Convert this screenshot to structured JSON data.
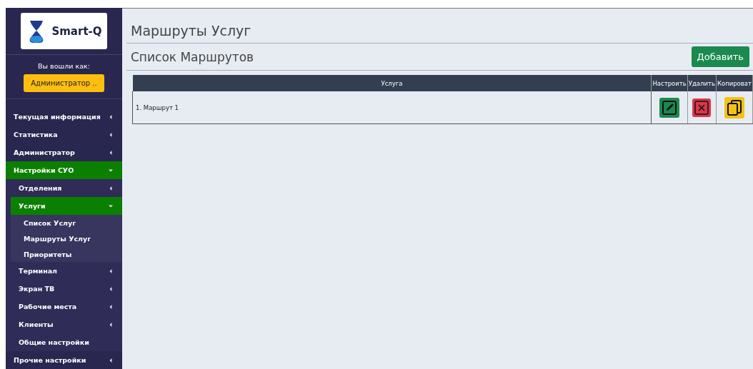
{
  "sidebar": {
    "logo": {
      "text": "Smart-Q"
    },
    "user_label": "Вы вошли как:",
    "user_button": "Администратор ..",
    "menu": [
      {
        "label": "Текущая информация",
        "expanded": false
      },
      {
        "label": "Статистика",
        "expanded": false
      },
      {
        "label": "Администратор",
        "expanded": false
      },
      {
        "label": "Настройки СУО",
        "expanded": true,
        "children": [
          {
            "label": "Отделения",
            "expanded": false
          },
          {
            "label": "Услуги",
            "expanded": true,
            "children": [
              {
                "label": "Список Услуг"
              },
              {
                "label": "Маршруты Услуг"
              },
              {
                "label": "Приоритеты"
              }
            ]
          },
          {
            "label": "Терминал",
            "expanded": false
          },
          {
            "label": "Экран ТВ",
            "expanded": false
          },
          {
            "label": "Рабочие места",
            "expanded": false
          },
          {
            "label": "Клиенты",
            "expanded": false
          },
          {
            "label": "Общие настройки"
          }
        ]
      },
      {
        "label": "Прочие настройки",
        "expanded": false
      }
    ]
  },
  "page_title": "Маршруты Услуг",
  "section_title": "Список Маршрутов",
  "add_button": "Добавить",
  "table": {
    "columns": [
      "Услуга",
      "Настроить",
      "Удалить",
      "Копироват"
    ],
    "rows": [
      {
        "name": "1. Маршрут 1"
      }
    ]
  }
}
